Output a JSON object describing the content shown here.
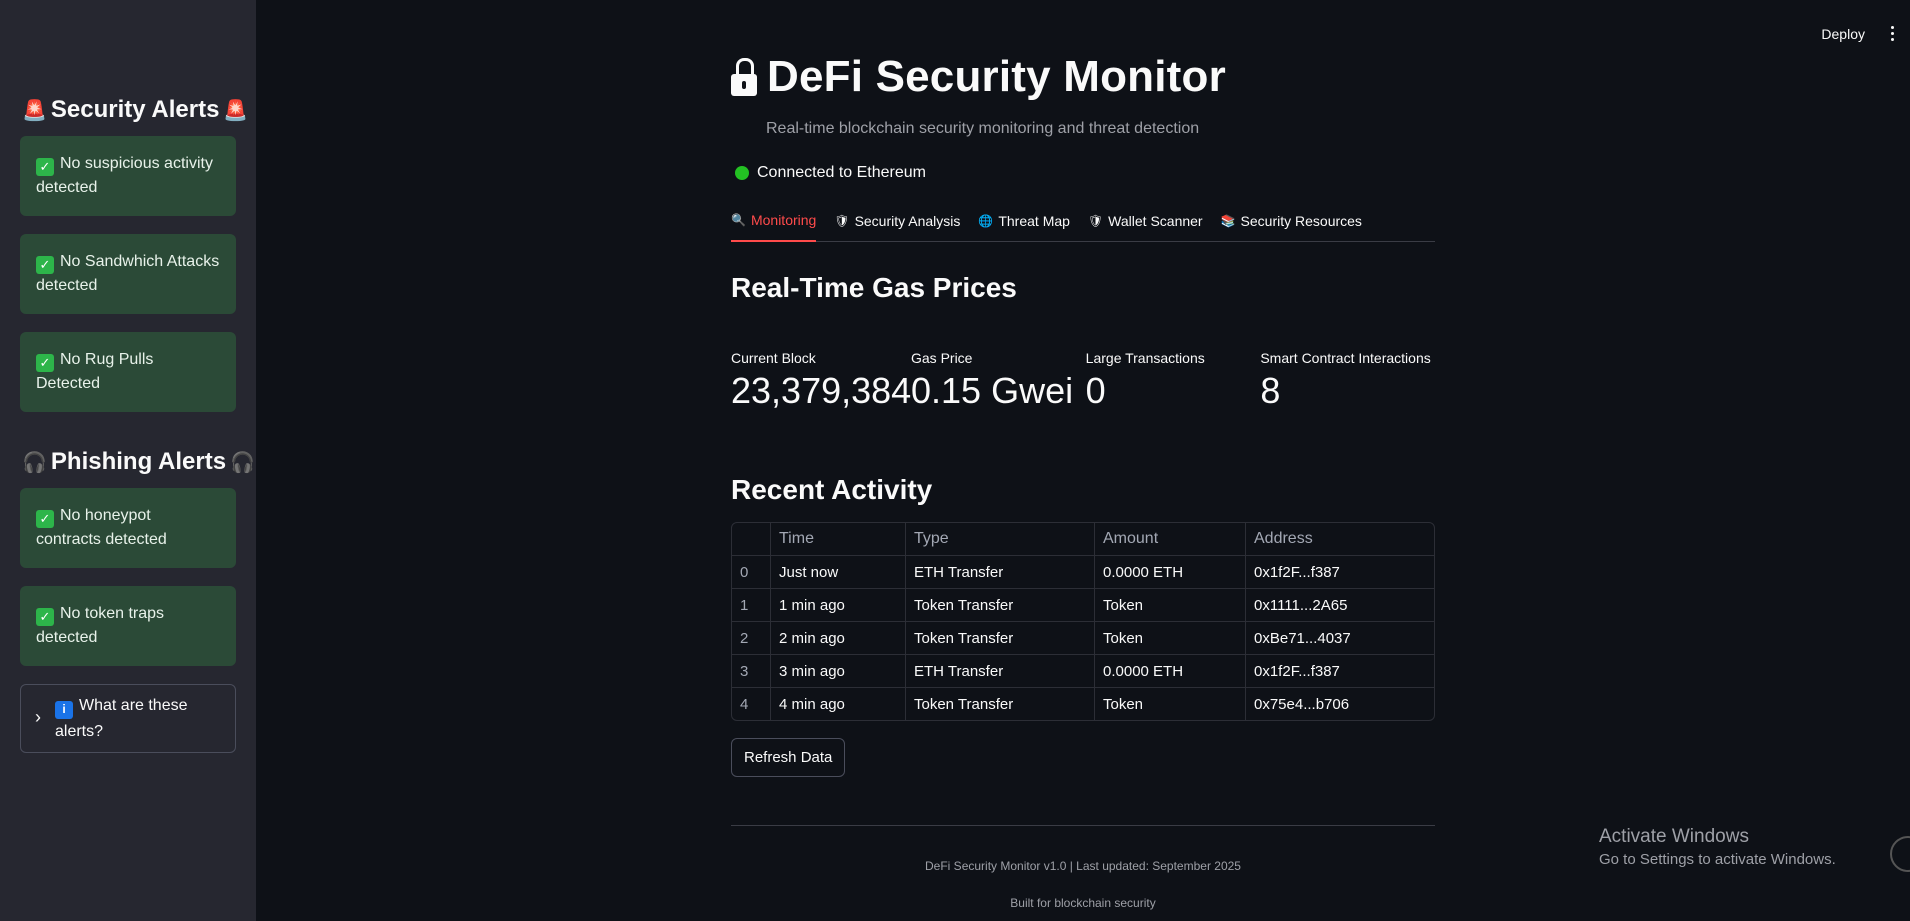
{
  "topbar": {
    "deploy_label": "Deploy"
  },
  "sidebar": {
    "security_header": "Security Alerts",
    "security_alerts": [
      "No suspicious activity detected",
      "No Sandwhich Attacks detected",
      "No Rug Pulls Detected"
    ],
    "phishing_header": "Phishing Alerts",
    "phishing_alerts": [
      "No honeypot contracts detected",
      "No token traps detected"
    ],
    "expander_label": "What are these alerts?"
  },
  "header": {
    "title": "DeFi Security Monitor",
    "subtitle": "Real-time blockchain security monitoring and threat detection",
    "connection_status": "Connected to Ethereum"
  },
  "tabs": [
    {
      "label": "Monitoring",
      "icon": "magnifier-icon",
      "active": true
    },
    {
      "label": "Security Analysis",
      "icon": "shield-icon",
      "active": false
    },
    {
      "label": "Threat Map",
      "icon": "globe-icon",
      "active": false
    },
    {
      "label": "Wallet Scanner",
      "icon": "shield-red-icon",
      "active": false
    },
    {
      "label": "Security Resources",
      "icon": "books-icon",
      "active": false
    }
  ],
  "gas": {
    "heading": "Real-Time Gas Prices",
    "metrics": [
      {
        "label": "Current Block",
        "value": "23,379,384"
      },
      {
        "label": "Gas Price",
        "value": "0.15 Gwei"
      },
      {
        "label": "Large Transactions",
        "value": "0"
      },
      {
        "label": "Smart Contract Interactions",
        "value": "8"
      }
    ]
  },
  "activity": {
    "heading": "Recent Activity",
    "columns": [
      "Time",
      "Type",
      "Amount",
      "Address"
    ],
    "rows": [
      {
        "idx": "0",
        "time": "Just now",
        "type": "ETH Transfer",
        "amount": "0.0000 ETH",
        "address": "0x1f2F...f387"
      },
      {
        "idx": "1",
        "time": "1 min ago",
        "type": "Token Transfer",
        "amount": "Token",
        "address": "0x1111...2A65"
      },
      {
        "idx": "2",
        "time": "2 min ago",
        "type": "Token Transfer",
        "amount": "Token",
        "address": "0xBe71...4037"
      },
      {
        "idx": "3",
        "time": "3 min ago",
        "type": "ETH Transfer",
        "amount": "0.0000 ETH",
        "address": "0x1f2F...f387"
      },
      {
        "idx": "4",
        "time": "4 min ago",
        "type": "Token Transfer",
        "amount": "Token",
        "address": "0x75e4...b706"
      }
    ],
    "refresh_label": "Refresh Data"
  },
  "footer": {
    "line1": "DeFi Security Monitor v1.0 | Last updated: September 2025",
    "line2": "Built for blockchain security"
  },
  "watermark": {
    "title": "Activate Windows",
    "subtitle": "Go to Settings to activate Windows."
  },
  "colors": {
    "background": "#0e1117",
    "sidebar": "#262730",
    "accent": "#ff4b4b",
    "success_box": "#2b4a37",
    "status_green": "#23c123"
  }
}
